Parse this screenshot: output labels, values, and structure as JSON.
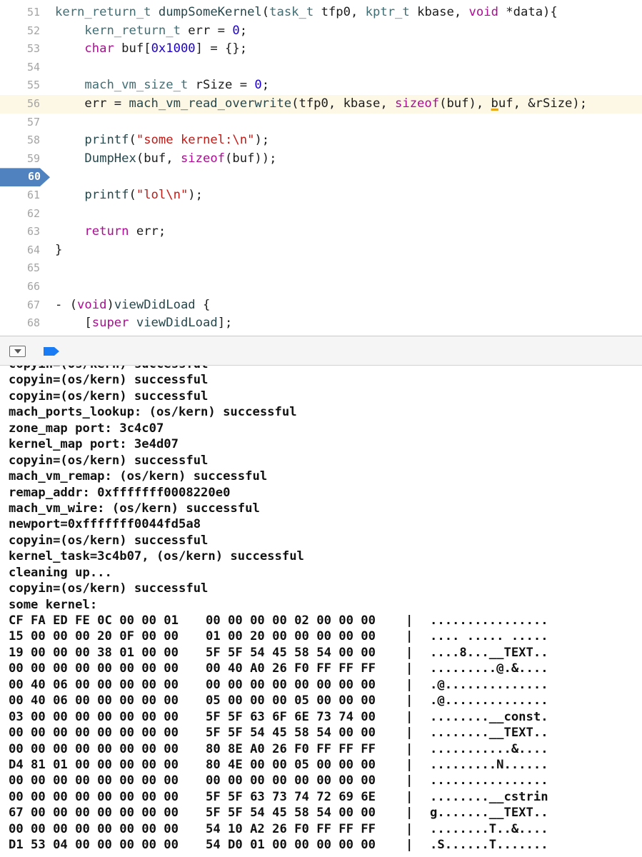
{
  "editor": {
    "breakpoint_line": "60",
    "highlighted_line": "56",
    "lines": [
      {
        "n": "51",
        "text": "kern_return_t dumpSomeKernel(task_t tfp0, kptr_t kbase, void *data){"
      },
      {
        "n": "52",
        "text": "    kern_return_t err = 0;"
      },
      {
        "n": "53",
        "text": "    char buf[0x1000] = {};"
      },
      {
        "n": "54",
        "text": ""
      },
      {
        "n": "55",
        "text": "    mach_vm_size_t rSize = 0;"
      },
      {
        "n": "56",
        "text": "    err = mach_vm_read_overwrite(tfp0, kbase, sizeof(buf), buf, &rSize);"
      },
      {
        "n": "57",
        "text": ""
      },
      {
        "n": "58",
        "text": "    printf(\"some kernel:\\n\");"
      },
      {
        "n": "59",
        "text": "    DumpHex(buf, sizeof(buf));"
      },
      {
        "n": "60",
        "text": ""
      },
      {
        "n": "61",
        "text": "    printf(\"lol\\n\");"
      },
      {
        "n": "62",
        "text": ""
      },
      {
        "n": "63",
        "text": "    return err;"
      },
      {
        "n": "64",
        "text": "}"
      },
      {
        "n": "65",
        "text": ""
      },
      {
        "n": "66",
        "text": ""
      },
      {
        "n": "67",
        "text": "- (void)viewDidLoad {"
      },
      {
        "n": "68",
        "text": "    [super viewDidLoad];"
      }
    ]
  },
  "debug_bar": {
    "hide_icon": "hide-debug-area-icon",
    "breakpoint_icon": "breakpoints-toggle-icon",
    "accent": "#1a7cf5"
  },
  "console": {
    "log_lines": [
      "copyin=(os/kern) successful",
      "copyin=(os/kern) successful",
      "copyin=(os/kern) successful",
      "mach_ports_lookup: (os/kern) successful",
      "zone_map port: 3c4c07",
      "kernel_map port: 3e4d07",
      "copyin=(os/kern) successful",
      "mach_vm_remap: (os/kern) successful",
      "remap_addr: 0xfffffff0008220e0",
      "mach_vm_wire: (os/kern) successful",
      "newport=0xfffffff0044fd5a8",
      "copyin=(os/kern) successful",
      "kernel_task=3c4b07, (os/kern) successful",
      "cleaning up...",
      "copyin=(os/kern) successful",
      "some kernel:"
    ],
    "hex_rows": [
      {
        "a": "CF FA ED FE 0C 00 00 01",
        "b": "00 00 00 00 02 00 00 00",
        "sep": "|",
        "ascii": "................"
      },
      {
        "a": "15 00 00 00 20 0F 00 00",
        "b": "01 00 20 00 00 00 00 00",
        "sep": "|",
        "ascii": ".... ..... ....."
      },
      {
        "a": "19 00 00 00 38 01 00 00",
        "b": "5F 5F 54 45 58 54 00 00",
        "sep": "|",
        "ascii": "....8...__TEXT.."
      },
      {
        "a": "00 00 00 00 00 00 00 00",
        "b": "00 40 A0 26 F0 FF FF FF",
        "sep": "|",
        "ascii": ".........@.&...."
      },
      {
        "a": "00 40 06 00 00 00 00 00",
        "b": "00 00 00 00 00 00 00 00",
        "sep": "|",
        "ascii": ".@.............."
      },
      {
        "a": "00 40 06 00 00 00 00 00",
        "b": "05 00 00 00 05 00 00 00",
        "sep": "|",
        "ascii": ".@.............."
      },
      {
        "a": "03 00 00 00 00 00 00 00",
        "b": "5F 5F 63 6F 6E 73 74 00",
        "sep": "|",
        "ascii": "........__const."
      },
      {
        "a": "00 00 00 00 00 00 00 00",
        "b": "5F 5F 54 45 58 54 00 00",
        "sep": "|",
        "ascii": "........__TEXT.."
      },
      {
        "a": "00 00 00 00 00 00 00 00",
        "b": "80 8E A0 26 F0 FF FF FF",
        "sep": "|",
        "ascii": "...........&...."
      },
      {
        "a": "D4 81 01 00 00 00 00 00",
        "b": "80 4E 00 00 05 00 00 00",
        "sep": "|",
        "ascii": ".........N......"
      },
      {
        "a": "00 00 00 00 00 00 00 00",
        "b": "00 00 00 00 00 00 00 00",
        "sep": "|",
        "ascii": "................"
      },
      {
        "a": "00 00 00 00 00 00 00 00",
        "b": "5F 5F 63 73 74 72 69 6E",
        "sep": "|",
        "ascii": "........__cstrin"
      },
      {
        "a": "67 00 00 00 00 00 00 00",
        "b": "5F 5F 54 45 58 54 00 00",
        "sep": "|",
        "ascii": "g.......__TEXT.."
      },
      {
        "a": "00 00 00 00 00 00 00 00",
        "b": "54 10 A2 26 F0 FF FF FF",
        "sep": "|",
        "ascii": "........T..&...."
      },
      {
        "a": "D1 53 04 00 00 00 00 00",
        "b": "54 D0 01 00 00 00 00 00",
        "sep": "|",
        "ascii": ".S......T......."
      }
    ]
  }
}
